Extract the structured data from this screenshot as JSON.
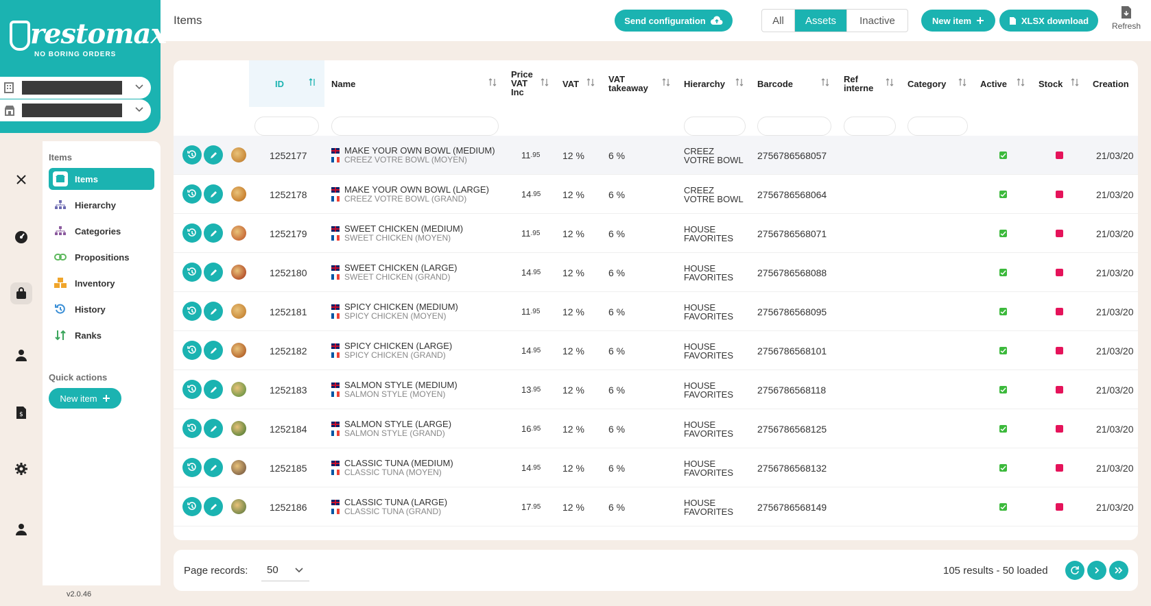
{
  "brand": {
    "logo_word": "restomax",
    "tagline": "NO BORING ORDERS"
  },
  "sidebar": {
    "section_items": "Items",
    "items": [
      {
        "label": "Items",
        "icon": "box-icon"
      },
      {
        "label": "Hierarchy",
        "icon": "hierarchy-icon"
      },
      {
        "label": "Categories",
        "icon": "categories-icon"
      },
      {
        "label": "Propositions",
        "icon": "link-icon"
      },
      {
        "label": "Inventory",
        "icon": "inventory-icon"
      },
      {
        "label": "History",
        "icon": "history-icon"
      },
      {
        "label": "Ranks",
        "icon": "ranks-icon"
      }
    ],
    "section_quick": "Quick actions",
    "quick_new_item": "New item",
    "version": "v2.0.46"
  },
  "header": {
    "title": "Items",
    "send_configuration": "Send configuration",
    "filters": [
      "All",
      "Assets",
      "Inactive"
    ],
    "active_filter": "Assets",
    "new_item": "New item",
    "xlsx_download": "XLSX download",
    "refresh": "Refresh"
  },
  "table": {
    "columns": {
      "id": "ID",
      "name": "Name",
      "price_l1": "Price",
      "price_l2": "VAT",
      "price_l3": "Inc",
      "vat": "VAT",
      "vat_takeaway_l1": "VAT",
      "vat_takeaway_l2": "takeaway",
      "hierarchy": "Hierarchy",
      "barcode": "Barcode",
      "ref_l1": "Ref",
      "ref_l2": "interne",
      "category": "Category",
      "active": "Active",
      "stock": "Stock",
      "creation": "Creation"
    },
    "rows": [
      {
        "id": "1252177",
        "name_en": "MAKE YOUR OWN BOWL (MEDIUM)",
        "name_fr": "CREEZ VOTRE BOWL (MOYEN)",
        "price_int": "11",
        "price_dec": ".95",
        "vat": "12 %",
        "vat_takeaway": "6 %",
        "hierarchy": "CREEZ VOTRE BOWL",
        "barcode": "2756786568057",
        "creation": "21/03/20"
      },
      {
        "id": "1252178",
        "name_en": "MAKE YOUR OWN BOWL (LARGE)",
        "name_fr": "CREEZ VOTRE BOWL (GRAND)",
        "price_int": "14",
        "price_dec": ".95",
        "vat": "12 %",
        "vat_takeaway": "6 %",
        "hierarchy": "CREEZ VOTRE BOWL",
        "barcode": "2756786568064",
        "creation": "21/03/20"
      },
      {
        "id": "1252179",
        "name_en": "SWEET CHICKEN (MEDIUM)",
        "name_fr": "SWEET CHICKEN (MOYEN)",
        "price_int": "11",
        "price_dec": ".95",
        "vat": "12 %",
        "vat_takeaway": "6 %",
        "hierarchy": "HOUSE FAVORITES",
        "barcode": "2756786568071",
        "creation": "21/03/20"
      },
      {
        "id": "1252180",
        "name_en": "SWEET CHICKEN (LARGE)",
        "name_fr": "SWEET CHICKEN (GRAND)",
        "price_int": "14",
        "price_dec": ".95",
        "vat": "12 %",
        "vat_takeaway": "6 %",
        "hierarchy": "HOUSE FAVORITES",
        "barcode": "2756786568088",
        "creation": "21/03/20"
      },
      {
        "id": "1252181",
        "name_en": "SPICY CHICKEN (MEDIUM)",
        "name_fr": "SPICY CHICKEN (MOYEN)",
        "price_int": "11",
        "price_dec": ".95",
        "vat": "12 %",
        "vat_takeaway": "6 %",
        "hierarchy": "HOUSE FAVORITES",
        "barcode": "2756786568095",
        "creation": "21/03/20"
      },
      {
        "id": "1252182",
        "name_en": "SPICY CHICKEN (LARGE)",
        "name_fr": "SPICY CHICKEN (GRAND)",
        "price_int": "14",
        "price_dec": ".95",
        "vat": "12 %",
        "vat_takeaway": "6 %",
        "hierarchy": "HOUSE FAVORITES",
        "barcode": "2756786568101",
        "creation": "21/03/20"
      },
      {
        "id": "1252183",
        "name_en": "SALMON STYLE (MEDIUM)",
        "name_fr": "SALMON STYLE (MOYEN)",
        "price_int": "13",
        "price_dec": ".95",
        "vat": "12 %",
        "vat_takeaway": "6 %",
        "hierarchy": "HOUSE FAVORITES",
        "barcode": "2756786568118",
        "creation": "21/03/20"
      },
      {
        "id": "1252184",
        "name_en": "SALMON STYLE (LARGE)",
        "name_fr": "SALMON STYLE (GRAND)",
        "price_int": "16",
        "price_dec": ".95",
        "vat": "12 %",
        "vat_takeaway": "6 %",
        "hierarchy": "HOUSE FAVORITES",
        "barcode": "2756786568125",
        "creation": "21/03/20"
      },
      {
        "id": "1252185",
        "name_en": "CLASSIC TUNA (MEDIUM)",
        "name_fr": "CLASSIC TUNA (MOYEN)",
        "price_int": "14",
        "price_dec": ".95",
        "vat": "12 %",
        "vat_takeaway": "6 %",
        "hierarchy": "HOUSE FAVORITES",
        "barcode": "2756786568132",
        "creation": "21/03/20"
      },
      {
        "id": "1252186",
        "name_en": "CLASSIC TUNA (LARGE)",
        "name_fr": "CLASSIC TUNA (GRAND)",
        "price_int": "17",
        "price_dec": ".95",
        "vat": "12 %",
        "vat_takeaway": "6 %",
        "hierarchy": "HOUSE FAVORITES",
        "barcode": "2756786568149",
        "creation": "21/03/20"
      }
    ]
  },
  "footer": {
    "page_records_label": "Page records:",
    "page_records_value": "50",
    "results": "105 results - 50 loaded"
  },
  "colors": {
    "accent": "#1bb3b1",
    "active_check": "#3cb93c",
    "stock_off": "#e5135a",
    "background": "#f5ede6"
  }
}
